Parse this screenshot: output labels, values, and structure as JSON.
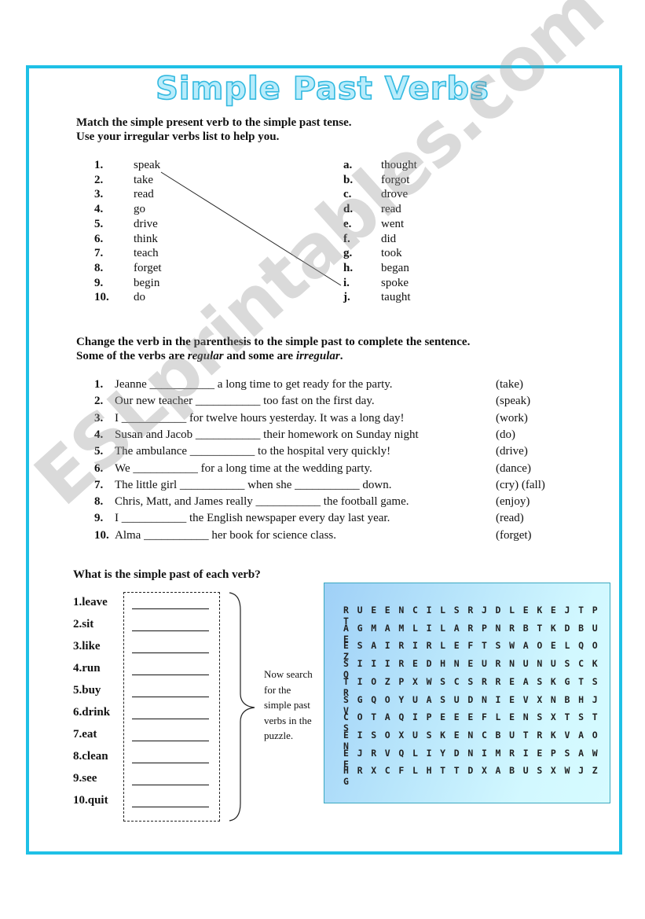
{
  "title": "Simple Past Verbs",
  "watermark": "ESLprintables.com",
  "colors": {
    "frame": "#1ec0e6",
    "title_fill": "#b9ecfb",
    "title_stroke": "#33b9e0",
    "puzzle_bg_left": "#9fd0f7",
    "puzzle_bg_right": "#d6fbff"
  },
  "section1": {
    "instructions": [
      "Match the simple present verb to the simple past tense.",
      "Use your irregular verbs list to help you."
    ],
    "present": [
      {
        "num": "1.",
        "word": "speak"
      },
      {
        "num": "2.",
        "word": "take"
      },
      {
        "num": "3.",
        "word": "read"
      },
      {
        "num": "4.",
        "word": "go"
      },
      {
        "num": "5.",
        "word": "drive"
      },
      {
        "num": "6.",
        "word": "think"
      },
      {
        "num": "7.",
        "word": "teach"
      },
      {
        "num": "8.",
        "word": "forget"
      },
      {
        "num": "9.",
        "word": "begin"
      },
      {
        "num": "10.",
        "word": "do"
      }
    ],
    "past": [
      {
        "letter": "a.",
        "word": "thought"
      },
      {
        "letter": "b.",
        "word": "forgot"
      },
      {
        "letter": "c.",
        "word": "drove"
      },
      {
        "letter": "d.",
        "word": "read"
      },
      {
        "letter": "e.",
        "word": "went"
      },
      {
        "letter": "f.",
        "word": "did"
      },
      {
        "letter": "g.",
        "word": "took"
      },
      {
        "letter": "h.",
        "word": "began"
      },
      {
        "letter": "i.",
        "word": "spoke"
      },
      {
        "letter": "j.",
        "word": "taught"
      }
    ],
    "example_match": {
      "from": "speak",
      "to": "spoke"
    }
  },
  "section2": {
    "instruction_line1": "Change the verb in the parenthesis to the simple past to complete the sentence.",
    "instruction_line2_pre": "Some of the verbs are ",
    "instruction_regular": "regular",
    "instruction_mid": " and some are ",
    "instruction_irregular": "irregular",
    "instruction_end": ".",
    "sentences": [
      {
        "num": "1.",
        "text": "Jeanne ___________ a long time to get ready for the party.",
        "hint": "(take)"
      },
      {
        "num": "2.",
        "text": "Our new teacher ___________ too fast on the first day.",
        "hint": "(speak)"
      },
      {
        "num": "3.",
        "text": "I ___________ for twelve hours yesterday. It was a long day!",
        "hint": "(work)"
      },
      {
        "num": "4.",
        "text": "Susan and Jacob ___________ their homework on Sunday night",
        "hint": "(do)"
      },
      {
        "num": "5.",
        "text": "The ambulance ___________ to the hospital very quickly!",
        "hint": "(drive)"
      },
      {
        "num": "6.",
        "text": "We ___________ for a long time at the wedding party.",
        "hint": "(dance)"
      },
      {
        "num": "7.",
        "text": "The little girl ___________ when she ___________ down.",
        "hint": "(cry) (fall)"
      },
      {
        "num": "8.",
        "text": "Chris, Matt, and James really ___________ the football game.",
        "hint": "(enjoy)"
      },
      {
        "num": "9.",
        "text": "I ___________ the English newspaper every day last year.",
        "hint": "(read)"
      },
      {
        "num": "10.",
        "text": "Alma ___________ her book for science class.",
        "hint": "(forget)"
      }
    ]
  },
  "section3": {
    "instruction": "What is the simple past of each verb?",
    "verbs": [
      "1.leave",
      "2.sit",
      "3.like",
      "4.run",
      "5.buy",
      "6.drink",
      "7.eat",
      "8.clean",
      "9.see",
      "10.quit"
    ],
    "note": "Now search for the simple past verbs in the puzzle."
  },
  "puzzle": {
    "rows": [
      "RUEENCILSRJDLEKEJTPT",
      "AGMAMLILARPNRBTKDBUE",
      "ESAIRIRLEFTSWAOELQOZ",
      "SIIIREDHNEURNUNUSCKQ",
      "TIOZPXWSCSRREASKGTSR",
      "SGQOYUASUDNIEVXNBHJV",
      "COTAQIPEEEFLENSXTSTS",
      "EISOXUSKENCBUTRKVAON",
      "EJRVQLIYDNIMRIEPSAWE",
      "HRXCFLHTTDXABUSXWJZG"
    ]
  }
}
